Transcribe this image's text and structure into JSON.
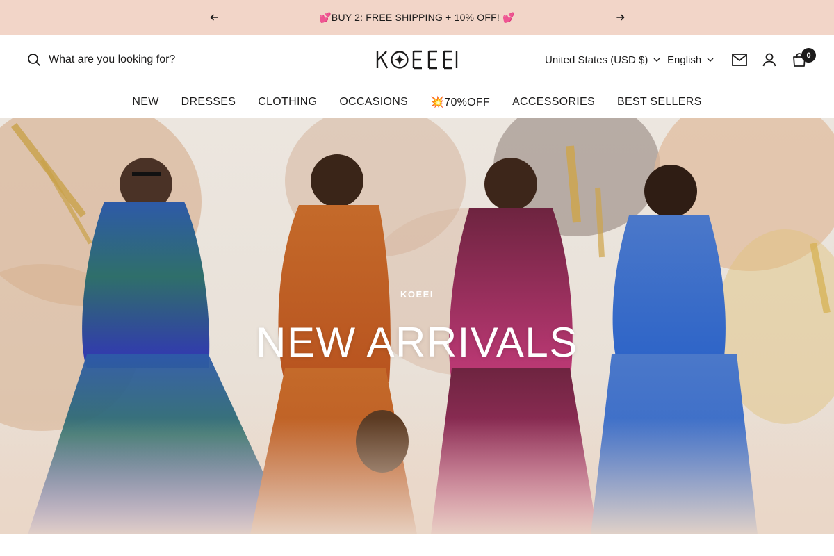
{
  "announcement": {
    "text": "💕BUY 2: FREE SHIPPING + 10% OFF! 💕",
    "background": "#f2d5c8"
  },
  "header": {
    "search_placeholder": "What are you looking for?",
    "logo_text": "KOEEI",
    "country": "United States (USD $)",
    "language": "English",
    "cart_count": "0"
  },
  "nav": {
    "items": [
      "NEW",
      "DRESSES",
      "CLOTHING",
      "OCCASIONS",
      "💥70%OFF",
      "ACCESSORIES",
      "BEST SELLERS"
    ]
  },
  "hero": {
    "eyebrow": "KOEEI",
    "title": "NEW ARRIVALS"
  },
  "colors": {
    "text": "#1c1b1b",
    "accent_bar": "#f2d5c8"
  }
}
